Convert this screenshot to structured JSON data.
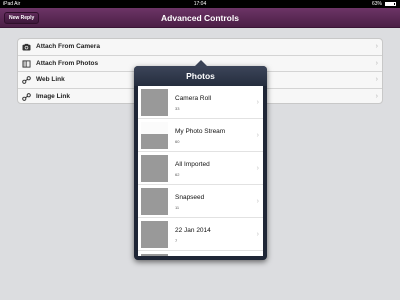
{
  "status": {
    "carrier": "iPad  Air",
    "time": "17:04",
    "battery": "63%"
  },
  "navbar": {
    "title": "Advanced Controls",
    "back_button": "New Reply"
  },
  "options": [
    {
      "label": "Attach From Camera",
      "icon": "camera-icon"
    },
    {
      "label": "Attach From Photos",
      "icon": "photos-icon"
    },
    {
      "label": "Web Link",
      "icon": "link-icon"
    },
    {
      "label": "Image Link",
      "icon": "link-icon"
    }
  ],
  "popover": {
    "title": "Photos",
    "albums": [
      {
        "name": "Camera Roll",
        "count": "33"
      },
      {
        "name": "My Photo Stream",
        "count": "60"
      },
      {
        "name": "All Imported",
        "count": "62"
      },
      {
        "name": "Snapseed",
        "count": "11"
      },
      {
        "name": "22 Jan 2014",
        "count": "7"
      }
    ]
  },
  "colors": {
    "navbar": "#5c2a56",
    "popover": "#1f2636",
    "background": "#dcdde0"
  }
}
